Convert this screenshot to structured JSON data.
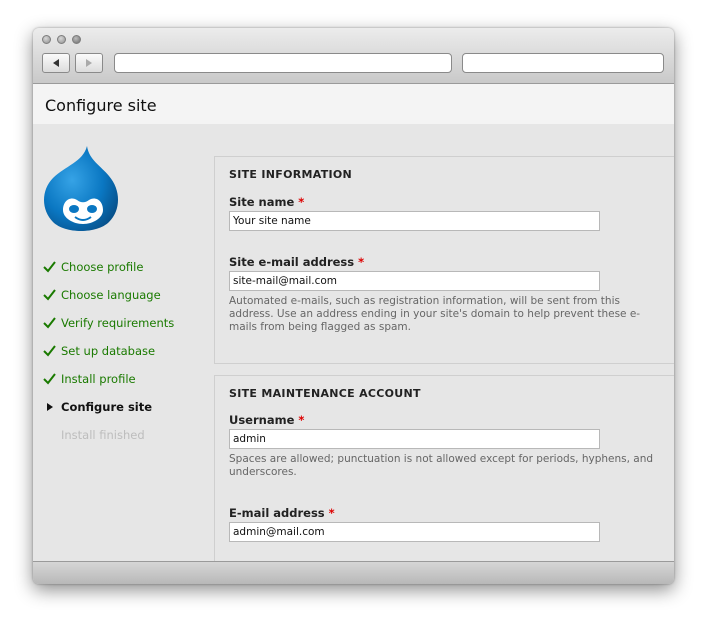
{
  "browser": {
    "url_value": "",
    "search_value": ""
  },
  "page": {
    "title": "Configure site"
  },
  "steps": [
    {
      "label": "Choose profile",
      "state": "done"
    },
    {
      "label": "Choose language",
      "state": "done"
    },
    {
      "label": "Verify requirements",
      "state": "done"
    },
    {
      "label": "Set up database",
      "state": "done"
    },
    {
      "label": "Install profile",
      "state": "done"
    },
    {
      "label": "Configure site",
      "state": "active"
    },
    {
      "label": "Install finished",
      "state": "pending"
    }
  ],
  "site_information": {
    "legend": "SITE INFORMATION",
    "site_name_label": "Site name",
    "site_name_value": "Your site name",
    "site_email_label": "Site e-mail address",
    "site_email_value": "site-mail@mail.com",
    "site_email_description": "Automated e-mails, such as registration information, will be sent from this address. Use an address ending in your site's domain to help prevent these e-mails from being flagged as spam."
  },
  "maintenance_account": {
    "legend": "SITE MAINTENANCE ACCOUNT",
    "username_label": "Username",
    "username_value": "admin",
    "username_description": "Spaces are allowed; punctuation is not allowed except for periods, hyphens, and underscores.",
    "email_label": "E-mail address",
    "email_value": "admin@mail.com"
  },
  "required_marker": "*",
  "colors": {
    "step_done": "#1a7a00",
    "required": "#dd0000",
    "drupal_blue": "#0a77c2"
  },
  "icons": [
    "back-arrow-icon",
    "forward-arrow-icon",
    "checkmark-icon",
    "current-step-arrow-icon",
    "drupal-logo"
  ]
}
